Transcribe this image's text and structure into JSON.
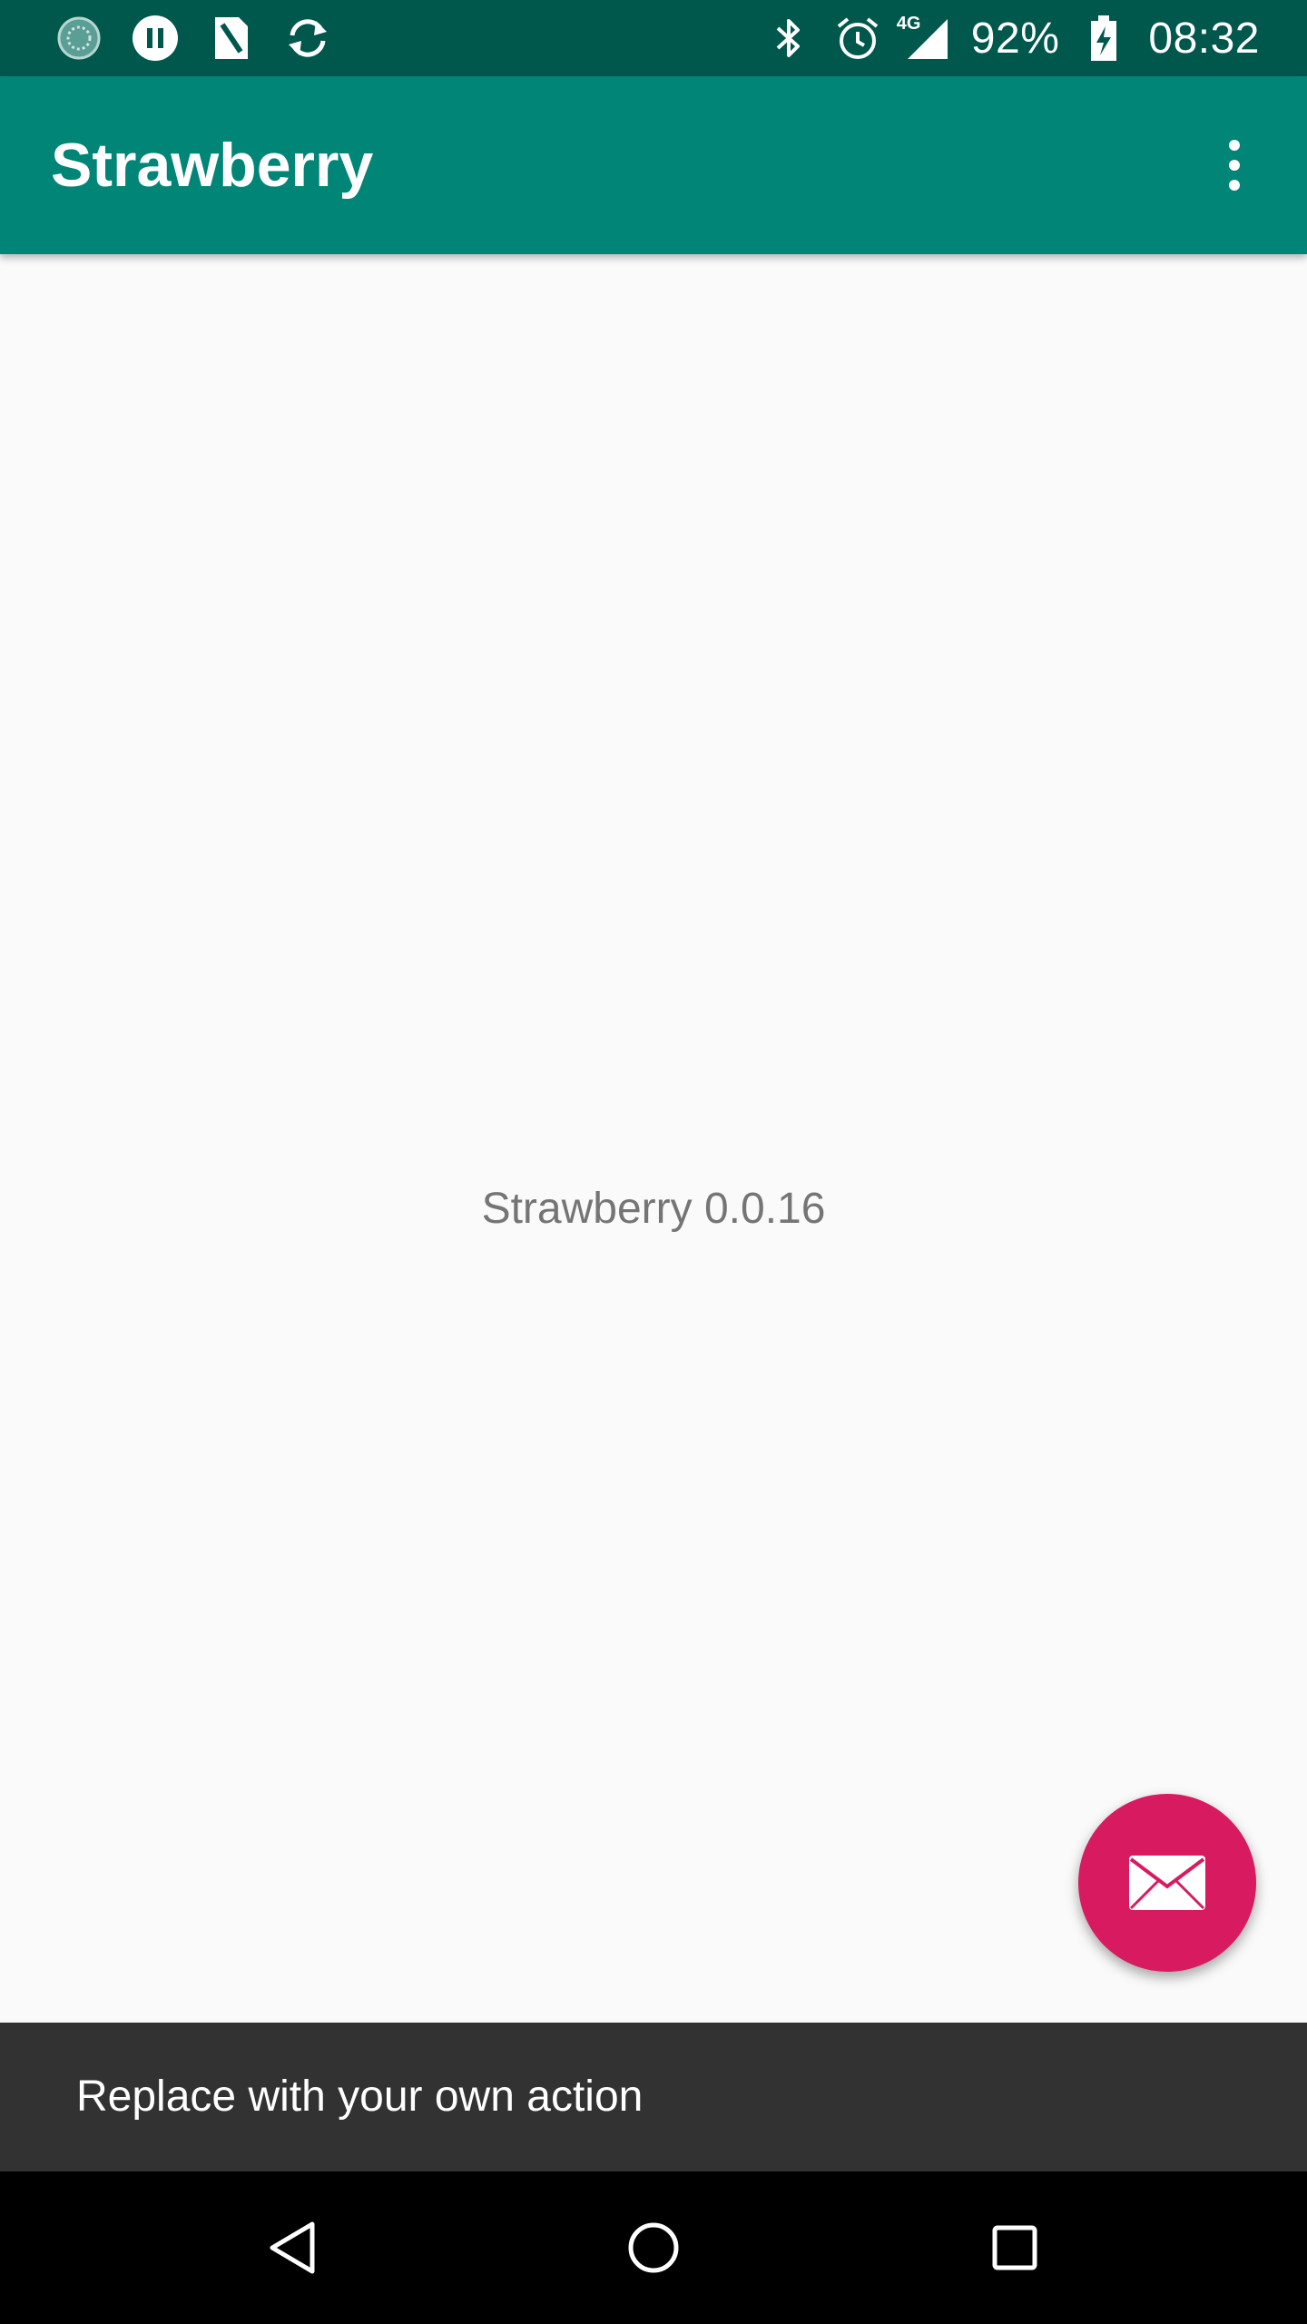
{
  "status_bar": {
    "battery_percent": "92%",
    "time": "08:32",
    "network_type": "4G",
    "left_icons": [
      "loading-icon",
      "pause-icon",
      "sim-card-icon",
      "sync-icon"
    ],
    "right_icons": [
      "bluetooth-icon",
      "alarm-icon",
      "signal-icon",
      "battery-charging-icon"
    ],
    "background_color": "#00574b"
  },
  "app_bar": {
    "title": "Strawberry",
    "menu_icon": "more-vert-icon",
    "background_color": "#008577"
  },
  "main": {
    "version_text": "Strawberry 0.0.16"
  },
  "fab": {
    "icon": "email-icon",
    "color": "#d81b60"
  },
  "snackbar": {
    "message": "Replace with your own action"
  },
  "nav_bar": {
    "icons": [
      "back-icon",
      "home-icon",
      "recents-icon"
    ]
  }
}
